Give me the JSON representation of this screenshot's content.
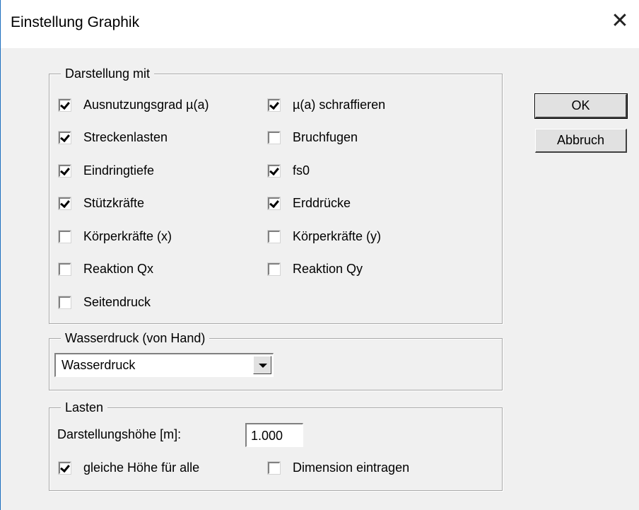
{
  "window": {
    "title": "Einstellung Graphik",
    "close_glyph": "✕"
  },
  "display_group": {
    "legend": "Darstellung mit",
    "left_items": [
      {
        "label": "Ausnutzungsgrad µ(a)",
        "checked": true
      },
      {
        "label": "Streckenlasten",
        "checked": true
      },
      {
        "label": "Eindringtiefe",
        "checked": true
      },
      {
        "label": "Stützkräfte",
        "checked": true
      },
      {
        "label": "Körperkräfte (x)",
        "checked": false
      },
      {
        "label": "Reaktion Qx",
        "checked": false
      },
      {
        "label": "Seitendruck",
        "checked": false
      }
    ],
    "right_items": [
      {
        "label": "µ(a) schraffieren",
        "checked": true
      },
      {
        "label": "Bruchfugen",
        "checked": false
      },
      {
        "label": "fs0",
        "checked": true
      },
      {
        "label": "Erddrücke",
        "checked": true
      },
      {
        "label": "Körperkräfte (y)",
        "checked": false
      },
      {
        "label": "Reaktion Qy",
        "checked": false
      }
    ]
  },
  "water_group": {
    "legend": "Wasserdruck (von Hand)",
    "select_value": "Wasserdruck"
  },
  "loads_group": {
    "legend": "Lasten",
    "height_label": "Darstellungshöhe [m]:",
    "height_value": "1.000",
    "same_height": {
      "label": "gleiche Höhe für alle",
      "checked": true
    },
    "dimension": {
      "label": "Dimension eintragen",
      "checked": false
    }
  },
  "buttons": {
    "ok": "OK",
    "cancel": "Abbruch"
  }
}
